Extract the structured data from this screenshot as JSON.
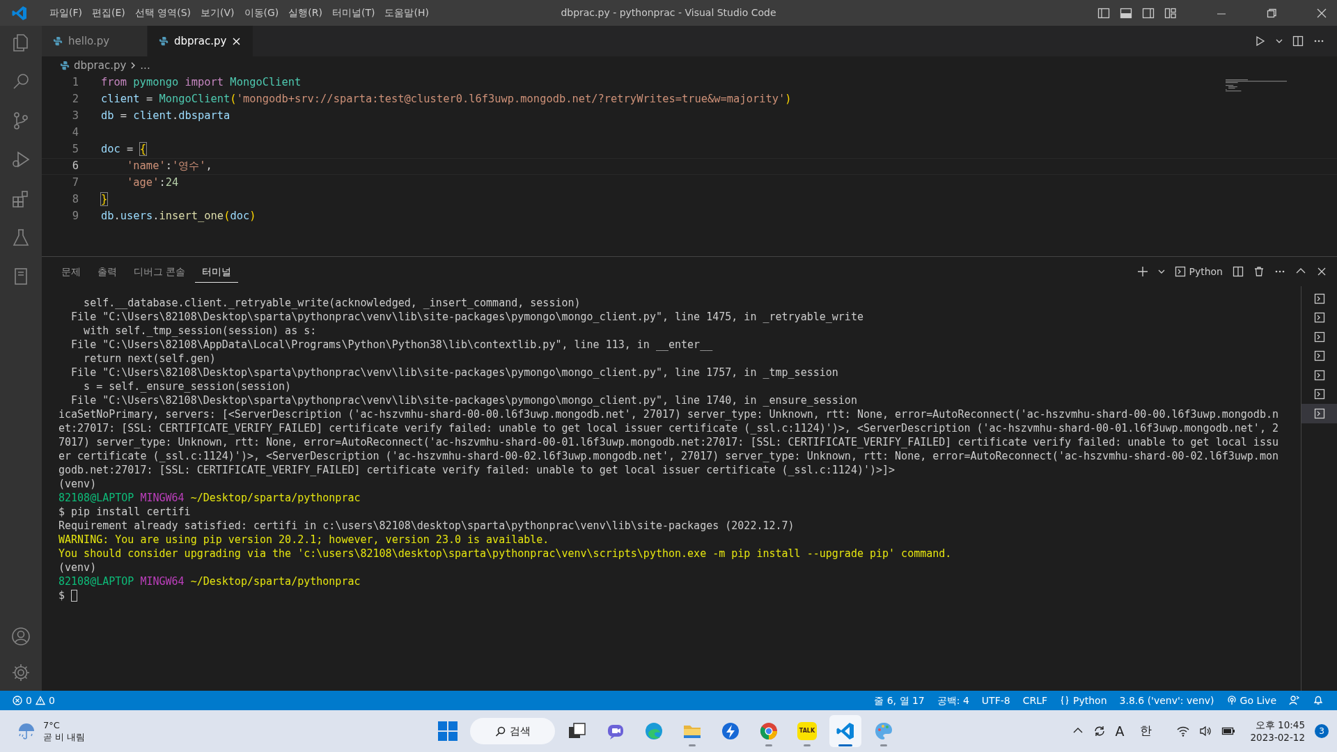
{
  "window": {
    "title": "dbprac.py - pythonprac - Visual Studio Code"
  },
  "menu": [
    "파일(F)",
    "편집(E)",
    "선택 영역(S)",
    "보기(V)",
    "이동(G)",
    "실행(R)",
    "터미널(T)",
    "도움말(H)"
  ],
  "tabs": [
    {
      "label": "hello.py",
      "selected": false
    },
    {
      "label": "dbprac.py",
      "selected": true
    }
  ],
  "breadcrumb": [
    "dbprac.py",
    "..."
  ],
  "editor": {
    "lines": [
      {
        "number": "1",
        "active": false,
        "tokens": [
          {
            "text": "from ",
            "kind": "keyword"
          },
          {
            "text": "pymongo ",
            "kind": "class"
          },
          {
            "text": "import ",
            "kind": "keyword"
          },
          {
            "text": "MongoClient",
            "kind": "class"
          }
        ]
      },
      {
        "number": "2",
        "active": false,
        "tokens": [
          {
            "text": "client",
            "kind": "variable"
          },
          {
            "text": " = ",
            "kind": "plain"
          },
          {
            "text": "MongoClient",
            "kind": "class"
          },
          {
            "text": "(",
            "kind": "bracket"
          },
          {
            "text": "'mongodb+srv://sparta:test@cluster0.l6f3uwp.mongodb.net/?retryWrites=true&w=majority'",
            "kind": "string"
          },
          {
            "text": ")",
            "kind": "bracket"
          }
        ]
      },
      {
        "number": "3",
        "active": false,
        "tokens": [
          {
            "text": "db",
            "kind": "variable"
          },
          {
            "text": " = ",
            "kind": "plain"
          },
          {
            "text": "client",
            "kind": "variable"
          },
          {
            "text": ".",
            "kind": "plain"
          },
          {
            "text": "dbsparta",
            "kind": "variable"
          }
        ]
      },
      {
        "number": "4",
        "active": false
      },
      {
        "number": "5",
        "active": false,
        "tokens": [
          {
            "text": "doc",
            "kind": "variable"
          },
          {
            "text": " = ",
            "kind": "plain"
          },
          {
            "text": "{",
            "kind": "bracket_match"
          }
        ]
      },
      {
        "number": "6",
        "active": true,
        "tokens": [
          {
            "text": "    'name'",
            "kind": "string"
          },
          {
            "text": ":",
            "kind": "plain"
          },
          {
            "text": "'영수'",
            "kind": "string"
          },
          {
            "text": ",",
            "kind": "plain"
          }
        ]
      },
      {
        "number": "7",
        "active": false,
        "tokens": [
          {
            "text": "    'age'",
            "kind": "string"
          },
          {
            "text": ":",
            "kind": "plain"
          },
          {
            "text": "24",
            "kind": "number"
          }
        ]
      },
      {
        "number": "8",
        "active": false,
        "tokens": [
          {
            "text": "}",
            "kind": "bracket_match"
          }
        ]
      },
      {
        "number": "9",
        "active": false,
        "tokens": [
          {
            "text": "db",
            "kind": "variable"
          },
          {
            "text": ".",
            "kind": "plain"
          },
          {
            "text": "users",
            "kind": "variable"
          },
          {
            "text": ".",
            "kind": "plain"
          },
          {
            "text": "insert_one",
            "kind": "function"
          },
          {
            "text": "(",
            "kind": "bracket"
          },
          {
            "text": "doc",
            "kind": "variable"
          },
          {
            "text": ")",
            "kind": "bracket"
          }
        ]
      }
    ]
  },
  "panel": {
    "tabs": [
      {
        "label": "문제",
        "selected": false
      },
      {
        "label": "출력",
        "selected": false
      },
      {
        "label": "디버그 콘솔",
        "selected": false
      },
      {
        "label": "터미널",
        "selected": true
      }
    ],
    "terminal_profile": "Python",
    "terminal_lines": [
      {
        "kind": "output",
        "text": "    self.__database.client._retryable_write(acknowledged, _insert_command, session)"
      },
      {
        "kind": "output",
        "text": "  File \"C:\\Users\\82108\\Desktop\\sparta\\pythonprac\\venv\\lib\\site-packages\\pymongo\\mongo_client.py\", line 1475, in _retryable_write"
      },
      {
        "kind": "output",
        "text": "    with self._tmp_session(session) as s:"
      },
      {
        "kind": "output",
        "text": "  File \"C:\\Users\\82108\\AppData\\Local\\Programs\\Python\\Python38\\lib\\contextlib.py\", line 113, in __enter__"
      },
      {
        "kind": "output",
        "text": "    return next(self.gen)"
      },
      {
        "kind": "output",
        "text": "  File \"C:\\Users\\82108\\Desktop\\sparta\\pythonprac\\venv\\lib\\site-packages\\pymongo\\mongo_client.py\", line 1757, in _tmp_session"
      },
      {
        "kind": "output",
        "text": "    s = self._ensure_session(session)"
      },
      {
        "kind": "output",
        "text": "  File \"C:\\Users\\82108\\Desktop\\sparta\\pythonprac\\venv\\lib\\site-packages\\pymongo\\mongo_client.py\", line 1740, in _ensure_session"
      },
      {
        "kind": "output",
        "text": "icaSetNoPrimary, servers: [<ServerDescription ('ac-hszvmhu-shard-00-00.l6f3uwp.mongodb.net', 27017) server_type: Unknown, rtt: None, error=AutoReconnect('ac-hszvmhu-shard-00-00.l6f3uwp.mongodb.n"
      },
      {
        "kind": "output",
        "text": "et:27017: [SSL: CERTIFICATE_VERIFY_FAILED] certificate verify failed: unable to get local issuer certificate (_ssl.c:1124)')>, <ServerDescription ('ac-hszvmhu-shard-00-01.l6f3uwp.mongodb.net', 2"
      },
      {
        "kind": "output",
        "text": "7017) server_type: Unknown, rtt: None, error=AutoReconnect('ac-hszvmhu-shard-00-01.l6f3uwp.mongodb.net:27017: [SSL: CERTIFICATE_VERIFY_FAILED] certificate verify failed: unable to get local issu"
      },
      {
        "kind": "output",
        "text": "er certificate (_ssl.c:1124)')>, <ServerDescription ('ac-hszvmhu-shard-00-02.l6f3uwp.mongodb.net', 27017) server_type: Unknown, rtt: None, error=AutoReconnect('ac-hszvmhu-shard-00-02.l6f3uwp.mon"
      },
      {
        "kind": "output",
        "text": "godb.net:27017: [SSL: CERTIFICATE_VERIFY_FAILED] certificate verify failed: unable to get local issuer certificate (_ssl.c:1124)')>]>"
      },
      {
        "kind": "output",
        "text": "(venv)"
      },
      {
        "kind": "prompt",
        "user": "82108@LAPTOP",
        "host": "MINGW64",
        "path": "~/Desktop/sparta/pythonprac"
      },
      {
        "kind": "output",
        "text": "$ pip install certifi"
      },
      {
        "kind": "output",
        "text": "Requirement already satisfied: certifi in c:\\users\\82108\\desktop\\sparta\\pythonprac\\venv\\lib\\site-packages (2022.12.7)"
      },
      {
        "kind": "warning",
        "text": "WARNING: You are using pip version 20.2.1; however, version 23.0 is available."
      },
      {
        "kind": "warning",
        "text": "You should consider upgrading via the 'c:\\users\\82108\\desktop\\sparta\\pythonprac\\venv\\scripts\\python.exe -m pip install --upgrade pip' command."
      },
      {
        "kind": "output",
        "text": "(venv)"
      },
      {
        "kind": "prompt",
        "user": "82108@LAPTOP",
        "host": "MINGW64",
        "path": "~/Desktop/sparta/pythonprac"
      },
      {
        "kind": "input",
        "text": "$"
      }
    ],
    "terminals": [
      {
        "selected": false
      },
      {
        "selected": false
      },
      {
        "selected": false
      },
      {
        "selected": false
      },
      {
        "selected": false
      },
      {
        "selected": false
      },
      {
        "selected": true
      }
    ]
  },
  "status_bar": {
    "errors": "0",
    "warnings": "0",
    "items": [
      {
        "kind": "plain",
        "text": "줄 6, 열 17"
      },
      {
        "kind": "plain",
        "text": "공백: 4"
      },
      {
        "kind": "plain",
        "text": "UTF-8"
      },
      {
        "kind": "plain",
        "text": "CRLF"
      },
      {
        "kind": "language",
        "text": "Python"
      },
      {
        "kind": "plain",
        "text": "3.8.6 ('venv': venv)"
      },
      {
        "kind": "live",
        "text": "Go Live"
      }
    ]
  },
  "taskbar": {
    "temperature": "7°C",
    "weather": "곧 비 내림",
    "search": "검색",
    "apps": [
      {
        "kind": "taskview",
        "running": false,
        "selected": false
      },
      {
        "kind": "chat",
        "running": false,
        "selected": false
      },
      {
        "kind": "edge",
        "running": false,
        "selected": false
      },
      {
        "kind": "folder",
        "running": true,
        "selected": false
      },
      {
        "kind": "arrow",
        "running": false,
        "selected": false
      },
      {
        "kind": "chrome",
        "running": true,
        "selected": false
      },
      {
        "kind": "talk",
        "label": "TALK",
        "running": true,
        "selected": false
      },
      {
        "kind": "vscode",
        "running": true,
        "selected": true
      },
      {
        "kind": "paint",
        "running": true,
        "selected": false
      }
    ],
    "input_mode": "A",
    "language": "한",
    "time": "오후 10:45",
    "date": "2023-02-12",
    "notifications": "3"
  }
}
